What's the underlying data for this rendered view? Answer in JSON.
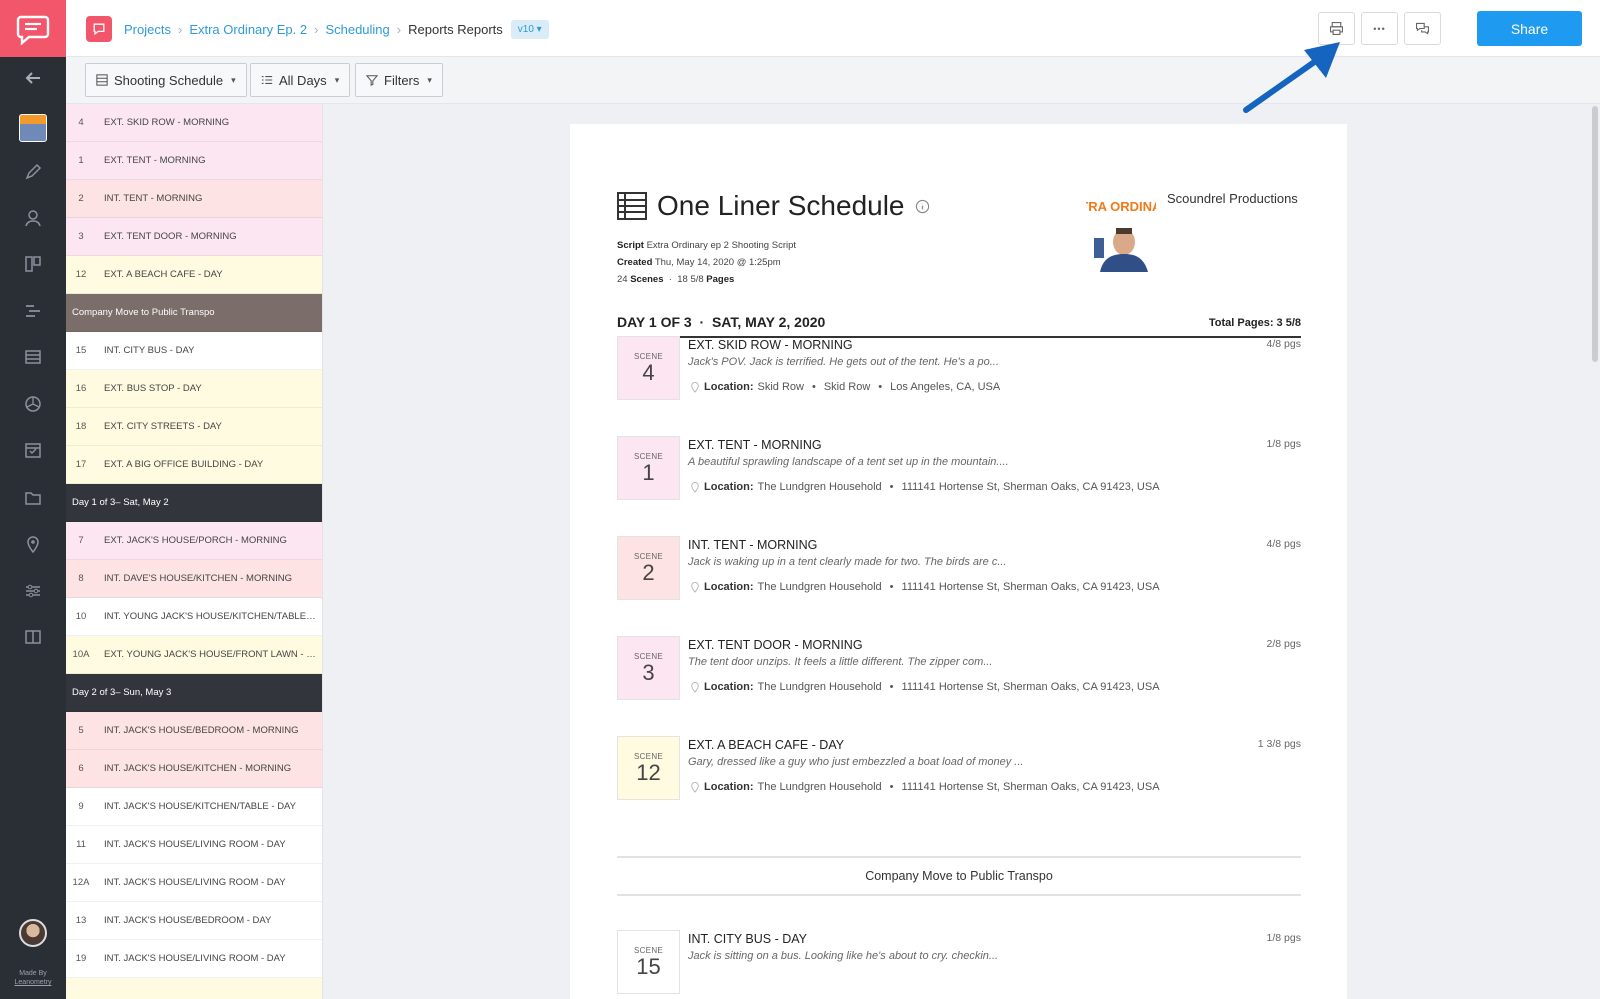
{
  "app": {
    "made_by_line1": "Made By",
    "made_by_line2": "Leanometry"
  },
  "breadcrumb": {
    "items": [
      "Projects",
      "Extra Ordinary Ep. 2",
      "Scheduling",
      "Reports Reports"
    ],
    "version": "v10"
  },
  "header_actions": {
    "more_label": "•••",
    "share_label": "Share"
  },
  "toolbar": {
    "report_type": "Shooting Schedule",
    "days": "All Days",
    "filters": "Filters"
  },
  "scene_list": [
    {
      "kind": "scene",
      "num": "4",
      "label": "EXT. SKID ROW - MORNING",
      "color": "#fce6f2"
    },
    {
      "kind": "scene",
      "num": "1",
      "label": "EXT. TENT - MORNING",
      "color": "#fce6f2"
    },
    {
      "kind": "scene",
      "num": "2",
      "label": "INT. TENT - MORNING",
      "color": "#fde3e3"
    },
    {
      "kind": "scene",
      "num": "3",
      "label": "EXT. TENT DOOR - MORNING",
      "color": "#fce6f2"
    },
    {
      "kind": "scene",
      "num": "12",
      "label": "EXT. A BEACH CAFE - DAY",
      "color": "#fefbe0"
    },
    {
      "kind": "banner",
      "label": "Company Move to Public Transpo",
      "color": "#7a6d6a"
    },
    {
      "kind": "scene",
      "num": "15",
      "label": "INT. CITY BUS - DAY",
      "color": "#ffffff"
    },
    {
      "kind": "scene",
      "num": "16",
      "label": "EXT. BUS STOP - DAY",
      "color": "#fefbe0"
    },
    {
      "kind": "scene",
      "num": "18",
      "label": "EXT. CITY STREETS - DAY",
      "color": "#fefbe0"
    },
    {
      "kind": "scene",
      "num": "17",
      "label": "EXT. A BIG OFFICE BUILDING - DAY",
      "color": "#fefbe0"
    },
    {
      "kind": "banner",
      "label": "Day 1 of 3– Sat, May 2",
      "color": "#32363c"
    },
    {
      "kind": "scene",
      "num": "7",
      "label": "EXT. JACK'S HOUSE/PORCH - MORNING",
      "color": "#fce6f2"
    },
    {
      "kind": "scene",
      "num": "8",
      "label": "INT. DAVE'S HOUSE/KITCHEN - MORNING",
      "color": "#fde3e3"
    },
    {
      "kind": "scene",
      "num": "10",
      "label": "INT. YOUNG JACK'S HOUSE/KITCHEN/TABLE -...",
      "color": "#ffffff"
    },
    {
      "kind": "scene",
      "num": "10A",
      "label": "EXT. YOUNG JACK'S HOUSE/FRONT LAWN - D...",
      "color": "#fefbe0"
    },
    {
      "kind": "banner",
      "label": "Day 2 of 3– Sun, May 3",
      "color": "#32363c"
    },
    {
      "kind": "scene",
      "num": "5",
      "label": "INT. JACK'S HOUSE/BEDROOM - MORNING",
      "color": "#fde3e3"
    },
    {
      "kind": "scene",
      "num": "6",
      "label": "INT. JACK'S HOUSE/KITCHEN - MORNING",
      "color": "#fde3e3"
    },
    {
      "kind": "scene",
      "num": "9",
      "label": "INT. JACK'S HOUSE/KITCHEN/TABLE - DAY",
      "color": "#ffffff"
    },
    {
      "kind": "scene",
      "num": "11",
      "label": "INT. JACK'S HOUSE/LIVING ROOM - DAY",
      "color": "#ffffff"
    },
    {
      "kind": "scene",
      "num": "12A",
      "label": "INT. JACK'S HOUSE/LIVING ROOM - DAY",
      "color": "#ffffff"
    },
    {
      "kind": "scene",
      "num": "13",
      "label": "INT. JACK'S HOUSE/BEDROOM - DAY",
      "color": "#ffffff"
    },
    {
      "kind": "scene",
      "num": "19",
      "label": "INT. JACK'S HOUSE/LIVING ROOM - DAY",
      "color": "#ffffff"
    },
    {
      "kind": "scene",
      "num": "",
      "label": "",
      "color": "#fefbe0"
    }
  ],
  "report": {
    "title": "One Liner Schedule",
    "script_label": "Script",
    "script_value": "Extra Ordinary ep 2 Shooting Script",
    "created_label": "Created",
    "created_value": "Thu, May 14, 2020 @ 1:25pm",
    "scenes_count": "24",
    "scenes_label": "Scenes",
    "pages_count": "18 5/8",
    "pages_label": "Pages",
    "poster_text": "EXTRA ORDINARY",
    "company": "Scoundrel Productions",
    "day_header": "DAY 1 OF 3",
    "day_sep": "·",
    "day_date": "SAT, MAY 2, 2020",
    "total_pages": "Total Pages: 3 5/8",
    "scene_label": "SCENE",
    "location_label": "Location:",
    "scenes": [
      {
        "num": "4",
        "heading": "EXT. SKID ROW - MORNING",
        "desc": "Jack's POV. Jack is terrified. He gets out of the tent. He's a po...",
        "loc1": "Skid Row",
        "loc2": "Skid Row",
        "loc3": "Los Angeles, CA, USA",
        "pages": "4/8 pgs",
        "color": "#fce6f2"
      },
      {
        "num": "1",
        "heading": "EXT. TENT - MORNING",
        "desc": "A beautiful sprawling landscape of a tent set up in the mountain....",
        "loc1": "The Lundgren Household",
        "loc2": "111141 Hortense St, Sherman Oaks, CA 91423, USA",
        "loc3": "",
        "pages": "1/8 pgs",
        "color": "#fce6f2"
      },
      {
        "num": "2",
        "heading": "INT. TENT - MORNING",
        "desc": "Jack is waking up in a tent clearly made for two. The birds are c...",
        "loc1": "The Lundgren Household",
        "loc2": "111141 Hortense St, Sherman Oaks, CA 91423, USA",
        "loc3": "",
        "pages": "4/8 pgs",
        "color": "#fde3e3"
      },
      {
        "num": "3",
        "heading": "EXT. TENT DOOR - MORNING",
        "desc": "The tent door unzips. It feels a little different. The zipper com...",
        "loc1": "The Lundgren Household",
        "loc2": "111141 Hortense St, Sherman Oaks, CA 91423, USA",
        "loc3": "",
        "pages": "2/8 pgs",
        "color": "#fce6f2"
      },
      {
        "num": "12",
        "heading": "EXT. A BEACH CAFE - DAY",
        "desc": "Gary, dressed like a guy who just embezzled a boat load of money ...",
        "loc1": "The Lundgren Household",
        "loc2": "111141 Hortense St, Sherman Oaks, CA 91423, USA",
        "loc3": "",
        "pages": "1 3/8 pgs",
        "color": "#fefbe0"
      }
    ],
    "move_banner": "Company Move to Public Transpo",
    "next_scene": {
      "num": "15",
      "heading": "INT. CITY BUS - DAY",
      "desc": "Jack is sitting on a bus. Looking like he's about to cry. checkin...",
      "pages": "1/8 pgs",
      "color": "#ffffff"
    }
  },
  "colors": {
    "brand": "#f2566b",
    "link": "#2e9bd8",
    "share": "#1e9bf0",
    "rail": "#2a2f36",
    "arrow": "#1565c0"
  }
}
